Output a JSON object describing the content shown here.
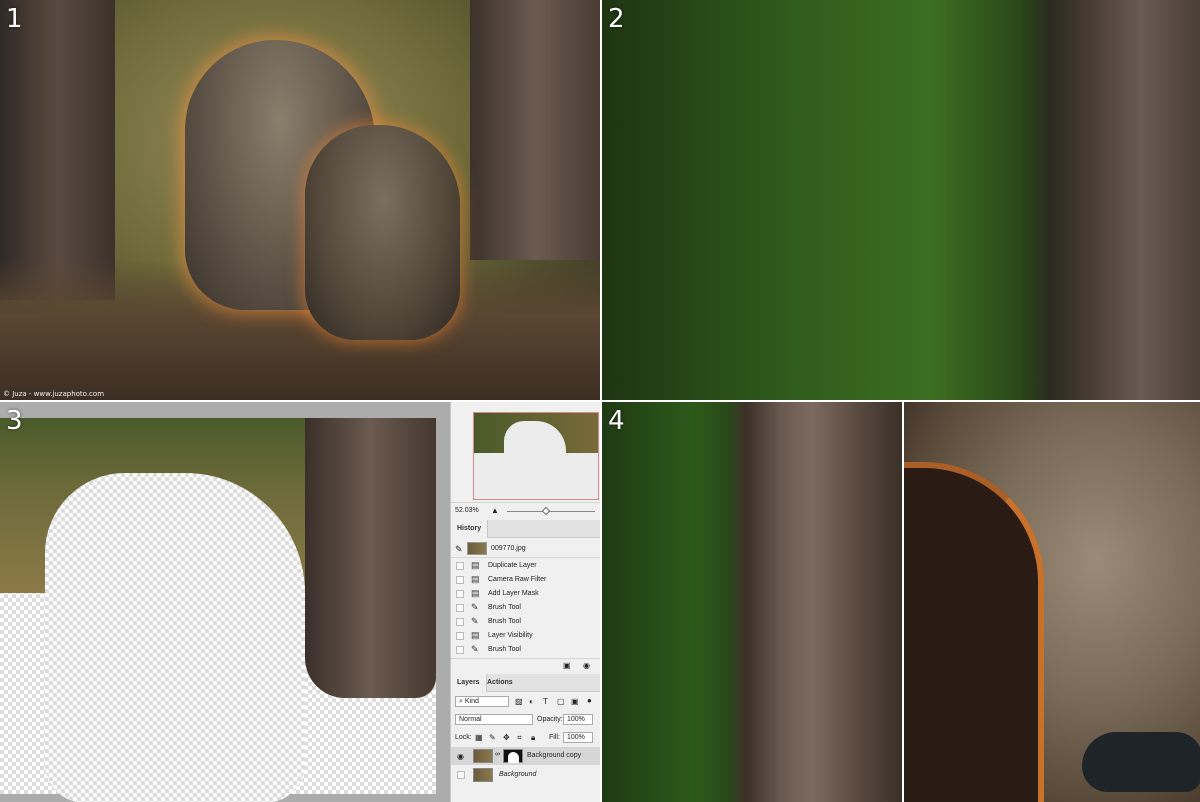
{
  "panels": {
    "p1": "1",
    "p2": "2",
    "p3": "3",
    "p4": "4"
  },
  "photo_credit": "© Juza - www.juzaphoto.com",
  "photoshop": {
    "zoom": "52.03%",
    "tabs": {
      "history": "History",
      "layers": "Layers",
      "actions": "Actions"
    },
    "history_snapshot": "009770.jpg",
    "history_items": [
      {
        "label": "Duplicate Layer",
        "icon": "document-icon"
      },
      {
        "label": "Camera Raw Filter",
        "icon": "document-icon"
      },
      {
        "label": "Add Layer Mask",
        "icon": "document-icon"
      },
      {
        "label": "Brush Tool",
        "icon": "brush-icon"
      },
      {
        "label": "Brush Tool",
        "icon": "brush-icon"
      },
      {
        "label": "Layer Visibility",
        "icon": "document-icon"
      },
      {
        "label": "Brush Tool",
        "icon": "brush-icon"
      }
    ],
    "layers": {
      "filter_kind": "Kind",
      "blend_mode": "Normal",
      "opacity_label": "Opacity:",
      "opacity_value": "100%",
      "lock_label": "Lock:",
      "fill_label": "Fill:",
      "fill_value": "100%",
      "items": [
        {
          "name": "Background copy",
          "visible": true,
          "selected": true,
          "has_mask": true
        },
        {
          "name": "Background",
          "visible": false,
          "selected": false,
          "has_mask": false
        }
      ]
    }
  }
}
